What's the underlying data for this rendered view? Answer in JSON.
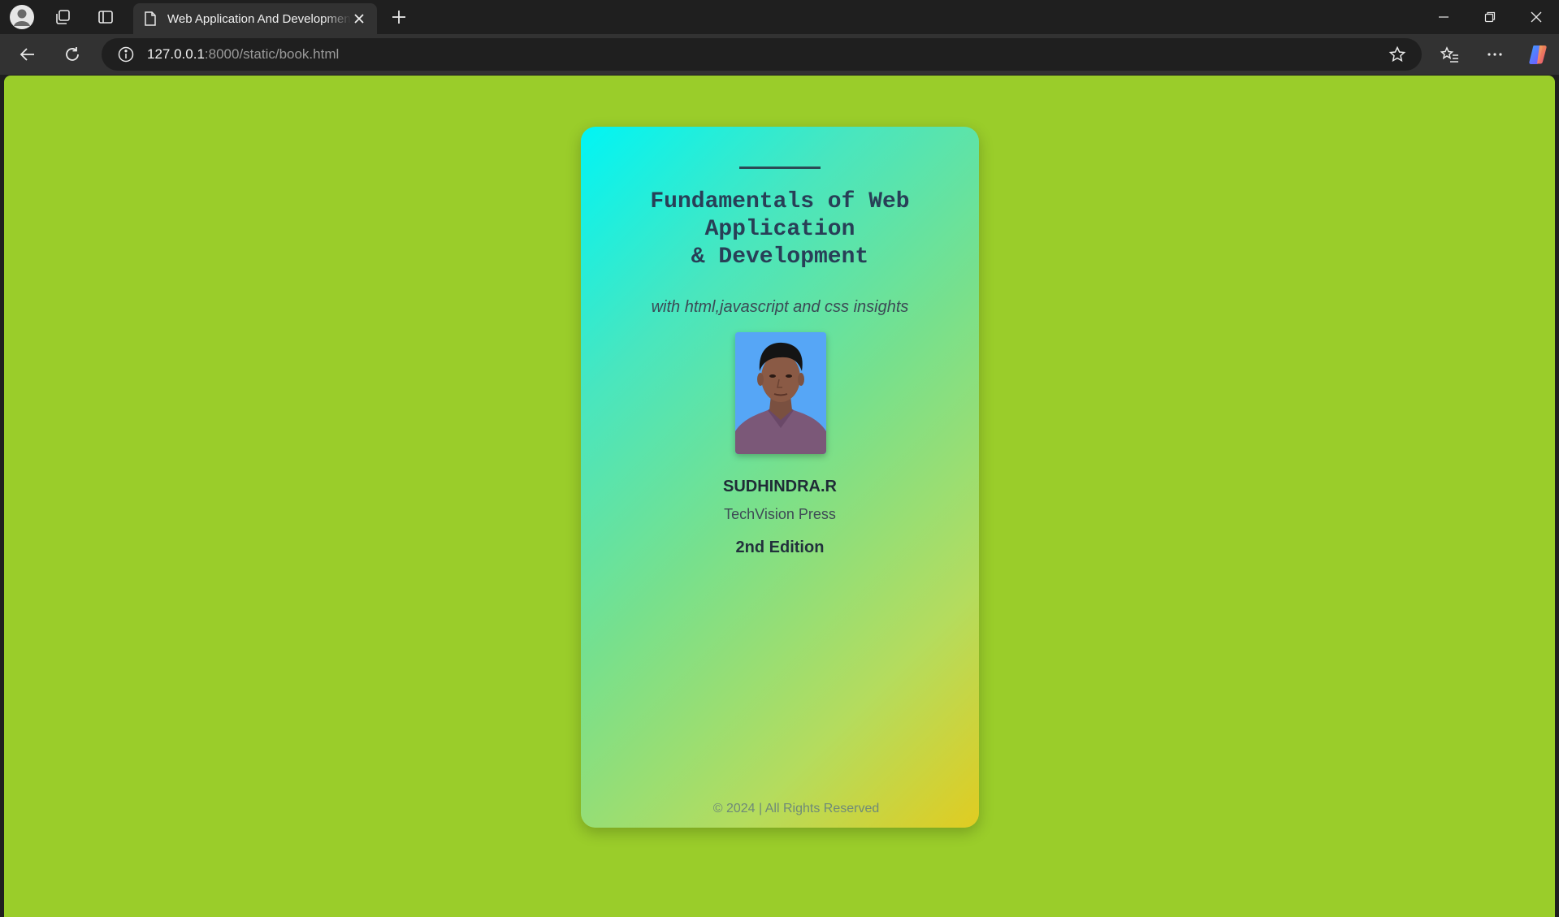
{
  "browser": {
    "tab_title": "Web Application And Development",
    "url_host": "127.0.0.1",
    "url_rest": ":8000/static/book.html"
  },
  "book": {
    "title": "Fundamentals of Web\nApplication\n& Development",
    "subtitle": "with html,javascript and css insights",
    "author": "SUDHINDRA.R",
    "publisher": "TechVision Press",
    "edition": "2nd Edition",
    "copyright": "© 2024 | All Rights Reserved"
  },
  "colors": {
    "page_background": "#9acd2a",
    "cover_gradient_start": "#00f5f5",
    "cover_gradient_end": "#e0cc21",
    "title_color": "#283f57"
  }
}
